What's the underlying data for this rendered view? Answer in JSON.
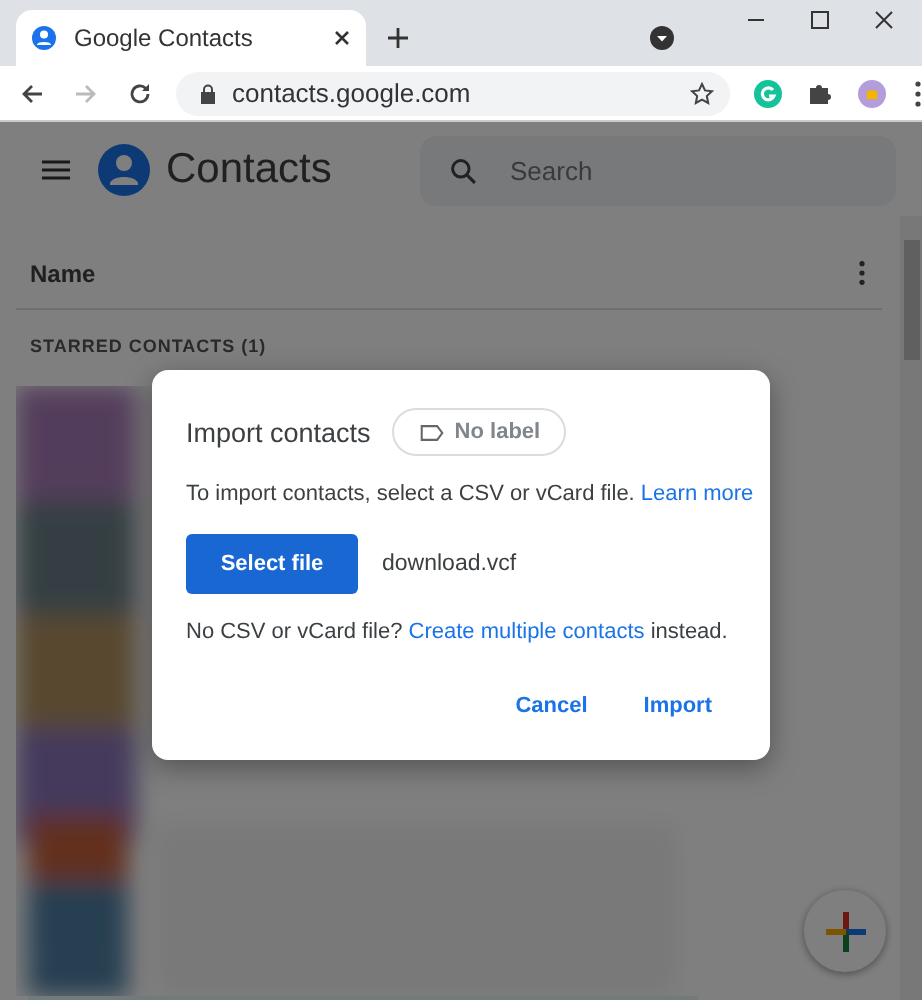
{
  "browser": {
    "tab": {
      "title": "Google Contacts"
    },
    "address": "contacts.google.com"
  },
  "app": {
    "title": "Contacts",
    "search": {
      "placeholder": "Search"
    },
    "list_header": "Name",
    "section": "STARRED CONTACTS (1)"
  },
  "dialog": {
    "title": "Import contacts",
    "label_chip": "No label",
    "intro": "To import contacts, select a CSV or vCard file.",
    "intro_link": "Learn more",
    "select_button": "Select file",
    "file_name": "download.vcf",
    "alt_text": "No CSV or vCard file?",
    "alt_link": "Create multiple contacts",
    "alt_tail": "instead.",
    "buttons": [
      {
        "label": "Cancel"
      },
      {
        "label": "Import"
      }
    ]
  }
}
